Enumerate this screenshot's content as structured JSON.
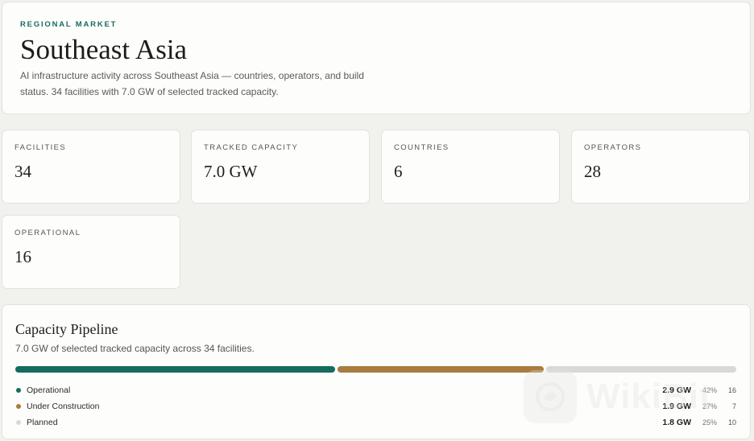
{
  "header": {
    "eyebrow": "REGIONAL MARKET",
    "title": "Southeast Asia",
    "description": "AI infrastructure activity across Southeast Asia — countries, operators, and build status. 34 facilities with 7.0 GW of selected tracked capacity."
  },
  "stats": [
    {
      "label": "FACILITIES",
      "value": "34"
    },
    {
      "label": "TRACKED CAPACITY",
      "value": "7.0 GW"
    },
    {
      "label": "COUNTRIES",
      "value": "6"
    },
    {
      "label": "OPERATORS",
      "value": "28"
    },
    {
      "label": "OPERATIONAL",
      "value": "16"
    }
  ],
  "pipeline": {
    "title": "Capacity Pipeline",
    "subtitle": "7.0 GW of selected tracked capacity across 34 facilities.",
    "segments": [
      {
        "label": "Operational",
        "gw": "2.9 GW",
        "pct": "42%",
        "share": 42,
        "count": "16",
        "color": "#156b5f"
      },
      {
        "label": "Under Construction",
        "gw": "1.9 GW",
        "pct": "27%",
        "share": 27,
        "count": "7",
        "color": "#a87b3f"
      },
      {
        "label": "Planned",
        "gw": "1.8 GW",
        "pct": "25%",
        "share": 25,
        "count": "10",
        "color": "#d9d9d5"
      }
    ]
  },
  "watermark": {
    "text": "WikiBit"
  }
}
